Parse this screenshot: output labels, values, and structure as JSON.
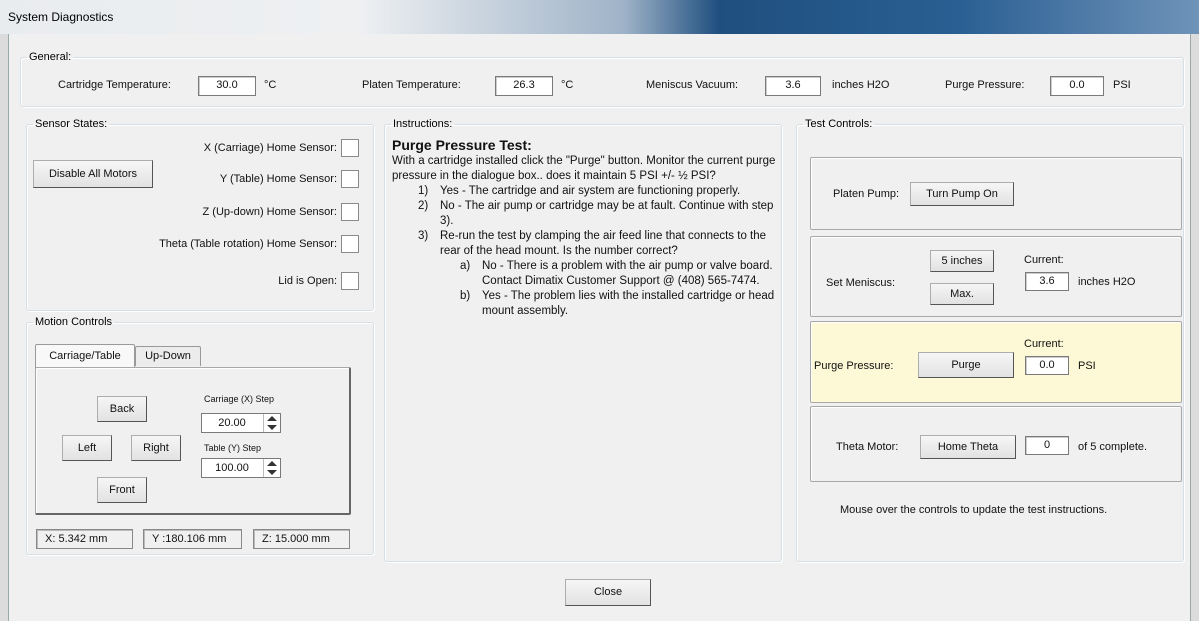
{
  "window": {
    "title": "System Diagnostics"
  },
  "general": {
    "legend": "General:",
    "cartridge_temp": {
      "label": "Cartridge Temperature:",
      "value": "30.0",
      "unit": "°C"
    },
    "platen_temp": {
      "label": "Platen Temperature:",
      "value": "26.3",
      "unit": "°C"
    },
    "meniscus_vacuum": {
      "label": "Meniscus Vacuum:",
      "value": "3.6",
      "unit": "inches H2O"
    },
    "purge_pressure": {
      "label": "Purge Pressure:",
      "value": "0.0",
      "unit": "PSI"
    }
  },
  "sensor_states": {
    "legend": "Sensor States:",
    "disable_motors": "Disable All Motors",
    "sensors": [
      {
        "label": "X (Carriage) Home Sensor:"
      },
      {
        "label": "Y (Table) Home Sensor:"
      },
      {
        "label": "Z (Up-down) Home Sensor:"
      },
      {
        "label": "Theta (Table rotation) Home Sensor:"
      },
      {
        "label": "Lid is Open:"
      }
    ]
  },
  "motion_controls": {
    "legend": "Motion Controls",
    "tabs": [
      "Carriage/Table",
      "Up-Down"
    ],
    "back": "Back",
    "left": "Left",
    "right": "Right",
    "front": "Front",
    "carriage_step_label": "Carriage (X) Step",
    "carriage_step_value": "20.00",
    "table_step_label": "Table (Y) Step",
    "table_step_value": "100.00",
    "x_pos": "X: 5.342 mm",
    "y_pos": "Y :180.106 mm",
    "z_pos": "Z: 15.000 mm"
  },
  "instructions": {
    "legend": "Instructions:",
    "heading": "Purge Pressure Test:",
    "intro": "With a cartridge installed click the \"Purge\" button. Monitor the current purge pressure in the dialogue box.. does it maintain 5 PSI +/- ½ PSI?",
    "steps": [
      {
        "num": "1)",
        "text": "Yes - The cartridge and air system are functioning properly."
      },
      {
        "num": "2)",
        "text": "No - The air pump or cartridge may be at fault. Continue with step 3)."
      },
      {
        "num": "3)",
        "text": "Re-run the test by clamping the air feed line that connects to the rear of the head mount. Is the number correct?"
      }
    ],
    "substeps": [
      {
        "num": "a)",
        "text": "No - There is a problem with the air pump or valve board. Contact Dimatix Customer Support @ (408) 565-7474."
      },
      {
        "num": "b)",
        "text": "Yes - The problem lies with the installed cartridge or head mount assembly."
      }
    ]
  },
  "test_controls": {
    "legend": "Test Controls:",
    "platen_pump_label": "Platen Pump:",
    "platen_pump_button": "Turn Pump On",
    "meniscus_label": "Set Meniscus:",
    "meniscus_5in": "5 inches",
    "meniscus_max": "Max.",
    "current_label": "Current:",
    "meniscus_current": "3.6",
    "meniscus_unit": "inches H2O",
    "purge_label": "Purge Pressure:",
    "purge_button": "Purge",
    "purge_current": "0.0",
    "purge_unit": "PSI",
    "theta_label": "Theta Motor:",
    "theta_button": "Home Theta",
    "theta_count": "0",
    "theta_suffix": "of 5 complete.",
    "hint": "Mouse over the controls to update the test instructions.",
    "highlight_color": "#fdf8d5"
  },
  "close_button": "Close"
}
